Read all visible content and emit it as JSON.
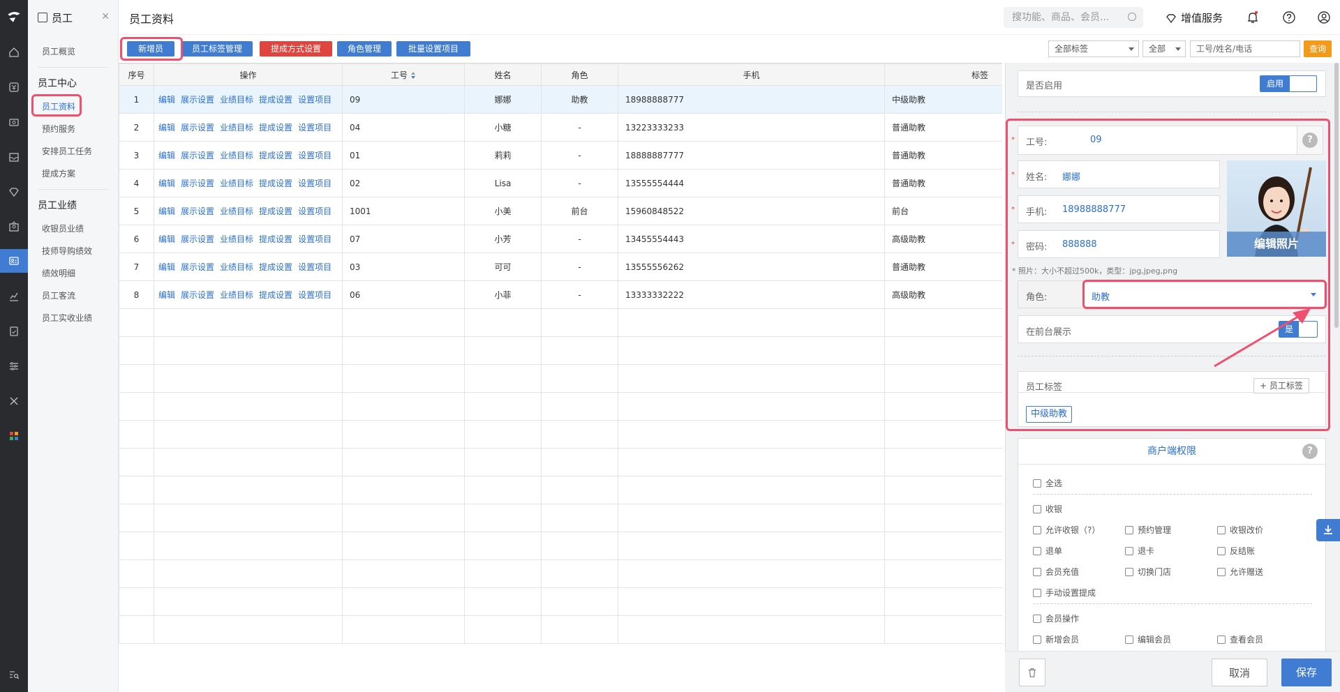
{
  "module": {
    "title": "员工"
  },
  "subnav": {
    "overview": "员工概览",
    "sec1": "员工中心",
    "items1": [
      "员工资料",
      "预约服务",
      "安排员工任务",
      "提成方案"
    ],
    "sec2": "员工业绩",
    "items2": [
      "收银员业绩",
      "技师导购绩效",
      "绩效明细",
      "员工客流",
      "员工实收业绩"
    ]
  },
  "header": {
    "title": "员工资料",
    "search_placeholder": "搜功能、商品、会员...",
    "vas": "增值服务"
  },
  "toolbar": {
    "buttons": [
      "新增员工",
      "员工标签管理",
      "提成方式设置",
      "角色管理",
      "批量设置项目"
    ],
    "filter_tags": "全部标签",
    "filter_all": "全部",
    "search_placeholder": "工号/姓名/电话",
    "query": "查询"
  },
  "table": {
    "columns": [
      "序号",
      "操作",
      "工号",
      "姓名",
      "角色",
      "手机",
      "标签"
    ],
    "ops": [
      "编辑",
      "展示设置",
      "业绩目标",
      "提成设置",
      "设置项目"
    ],
    "rows": [
      {
        "idx": "1",
        "code": "09",
        "name": "娜娜",
        "role": "助教",
        "phone": "18988888777",
        "tag": "中级助教"
      },
      {
        "idx": "2",
        "code": "04",
        "name": "小糖",
        "role": "-",
        "phone": "13223333233",
        "tag": "普通助教"
      },
      {
        "idx": "3",
        "code": "01",
        "name": "莉莉",
        "role": "-",
        "phone": "18888887777",
        "tag": "普通助教"
      },
      {
        "idx": "4",
        "code": "02",
        "name": "Lisa",
        "role": "-",
        "phone": "13555554444",
        "tag": "普通助教"
      },
      {
        "idx": "5",
        "code": "1001",
        "name": "小美",
        "role": "前台",
        "phone": "15960848522",
        "tag": "前台"
      },
      {
        "idx": "6",
        "code": "07",
        "name": "小芳",
        "role": "-",
        "phone": "13455554443",
        "tag": "高级助教"
      },
      {
        "idx": "7",
        "code": "03",
        "name": "可可",
        "role": "-",
        "phone": "13555556262",
        "tag": "普通助教"
      },
      {
        "idx": "8",
        "code": "06",
        "name": "小菲",
        "role": "-",
        "phone": "13333332222",
        "tag": "高级助教"
      }
    ]
  },
  "form": {
    "enabled_label": "是否启用",
    "enabled_value": "启用",
    "code_label": "工号:",
    "code_value": "09",
    "name_label": "姓名:",
    "name_value": "娜娜",
    "phone_label": "手机:",
    "phone_value": "18988888777",
    "pwd_label": "密码:",
    "pwd_value": "888888",
    "photo_edit": "编辑照片",
    "photo_hint": "* 照片：大小不超过500k，类型：jpg,jpeg,png",
    "role_label": "角色:",
    "role_value": "助教",
    "front_label": "在前台展示",
    "front_value": "是",
    "tag_label": "员工标签",
    "add_tag": "+ 员工标签",
    "tag_chip": "中级助教",
    "perm_title": "商户端权限",
    "perms": {
      "all": "全选",
      "cashier": "收银",
      "allow_cash": "允许收银（?）",
      "booking": "预约管理",
      "change_price": "收银改价",
      "refund": "退单",
      "refund_card": "退卡",
      "reverse": "反结账",
      "recharge": "会员充值",
      "switch_store": "切换门店",
      "gift": "允许赠送",
      "manual_comm": "手动设置提成",
      "member_op": "会员操作",
      "add_member": "新增会员",
      "edit_member": "编辑会员",
      "view_member": "查看会员"
    },
    "cancel": "取消",
    "save": "保存"
  },
  "colors": {
    "accent": "#3f7cd2",
    "danger": "#e0443e",
    "warn": "#f39a1a",
    "highlight": "#f0506e"
  }
}
